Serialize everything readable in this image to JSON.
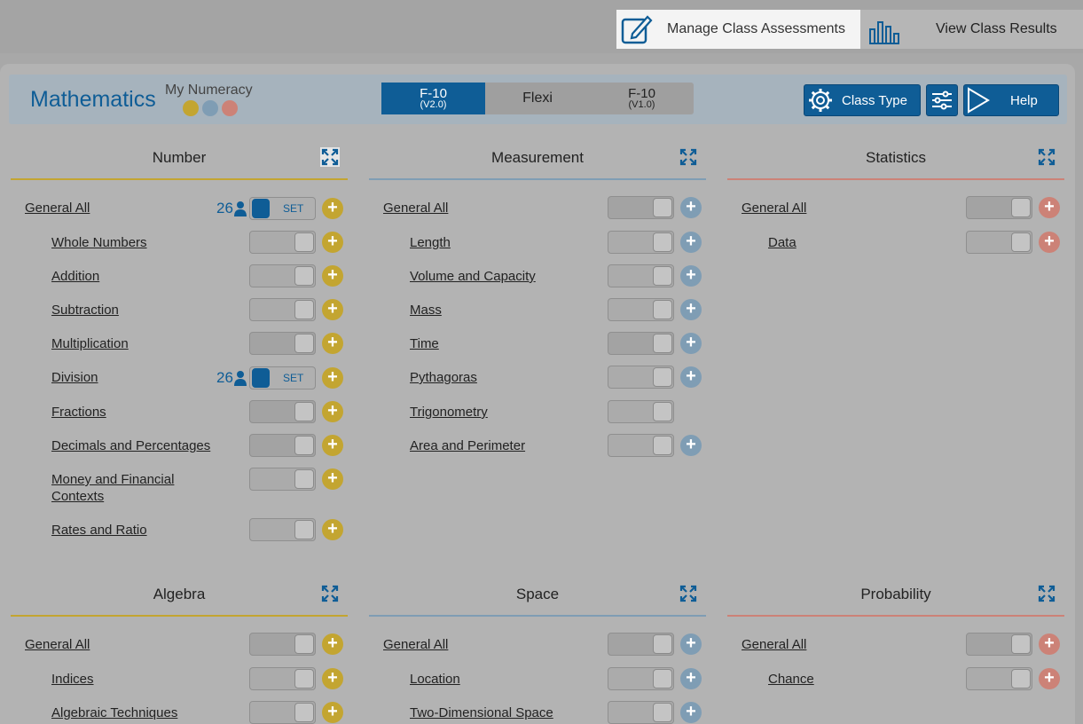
{
  "topbar": {
    "manage_label": "Manage Class Assessments",
    "view_label": "View Class Results"
  },
  "header": {
    "brand": "Mathematics",
    "subtitle": "My Numeracy",
    "segments": [
      {
        "title": "F-10",
        "sub": "(V2.0)",
        "active": true
      },
      {
        "title": "Flexi",
        "sub": "",
        "active": false
      },
      {
        "title": "F-10",
        "sub": "(V1.0)",
        "active": false
      }
    ],
    "class_type_label": "Class Type",
    "help_label": "Help"
  },
  "colors": {
    "brand": "#0f5d96",
    "number": "#c3a531",
    "measurement": "#7f9db4",
    "statistics": "#cc8277"
  },
  "sections": [
    {
      "title": "Number",
      "items": [
        {
          "label": "General All",
          "state": "set",
          "count": "26",
          "set_label": "SET"
        },
        {
          "label": "Whole Numbers",
          "state": "light"
        },
        {
          "label": "Addition",
          "state": "light"
        },
        {
          "label": "Subtraction",
          "state": "light"
        },
        {
          "label": "Multiplication",
          "state": "off"
        },
        {
          "label": "Division",
          "state": "set",
          "count": "26",
          "set_label": "SET"
        },
        {
          "label": "Fractions",
          "state": "off"
        },
        {
          "label": "Decimals and Percentages",
          "state": "off"
        },
        {
          "label": "Money and Financial Contexts",
          "state": "light"
        },
        {
          "label": "Rates and Ratio",
          "state": "light"
        }
      ]
    },
    {
      "title": "Measurement",
      "items": [
        {
          "label": "General All",
          "state": "off"
        },
        {
          "label": "Length",
          "state": "light"
        },
        {
          "label": "Volume and Capacity",
          "state": "light"
        },
        {
          "label": "Mass",
          "state": "light"
        },
        {
          "label": "Time",
          "state": "off"
        },
        {
          "label": "Pythagoras",
          "state": "light"
        },
        {
          "label": "Trigonometry",
          "state": "light"
        },
        {
          "label": "Area and Perimeter",
          "state": "light"
        }
      ]
    },
    {
      "title": "Statistics",
      "items": [
        {
          "label": "General All",
          "state": "off"
        },
        {
          "label": "Data",
          "state": "light"
        }
      ]
    },
    {
      "title": "Algebra",
      "items": [
        {
          "label": "General All",
          "state": "off"
        },
        {
          "label": "Indices",
          "state": "light"
        },
        {
          "label": "Algebraic Techniques",
          "state": "light"
        }
      ]
    },
    {
      "title": "Space",
      "items": [
        {
          "label": "General All",
          "state": "off"
        },
        {
          "label": "Location",
          "state": "light"
        },
        {
          "label": "Two-Dimensional Space",
          "state": "light"
        }
      ]
    },
    {
      "title": "Probability",
      "items": [
        {
          "label": "General All",
          "state": "off"
        },
        {
          "label": "Chance",
          "state": "light"
        }
      ]
    }
  ]
}
